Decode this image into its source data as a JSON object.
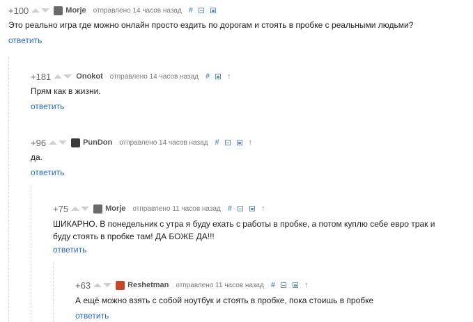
{
  "comments": [
    {
      "rating": "+100",
      "author": "Morje",
      "meta": "отправлено 14 часов назад",
      "text": "Это реально игра где можно онлайн просто ездить по дорогам и стоять в пробке с реальными людьми?",
      "reply": "ответить",
      "avatar_color": "#6a6a6a"
    },
    {
      "rating": "+181",
      "author": "Onokot",
      "meta": "отправлено 14 часов назад",
      "text": "Прям как в жизни.",
      "reply": "ответить",
      "avatar_color": ""
    },
    {
      "rating": "+96",
      "author": "PunDon",
      "meta": "отправлено 14 часов назад",
      "text": "да.",
      "reply": "ответить",
      "avatar_color": "#3a3a3a"
    },
    {
      "rating": "+75",
      "author": "Morje",
      "meta": "отправлено 11 часов назад",
      "text": "ШИКАРНО. В понедельник с утра я буду ехать с работы в пробке, а потом куплю себе евро трак и\nбуду стоять в пробке там! ДА БОЖЕ ДА!!!",
      "reply": "ответить",
      "avatar_color": "#6a6a6a"
    },
    {
      "rating": "+63",
      "author": "Reshetman",
      "meta": "отправлено 11 часов назад",
      "text": "А ещё можно взять с собой ноутбук и стоять в пробке, пока стоишь в пробке",
      "reply": "ответить",
      "avatar_color": "#c0492b"
    }
  ],
  "icons": {
    "hash": "#",
    "uparrow": "↑"
  }
}
